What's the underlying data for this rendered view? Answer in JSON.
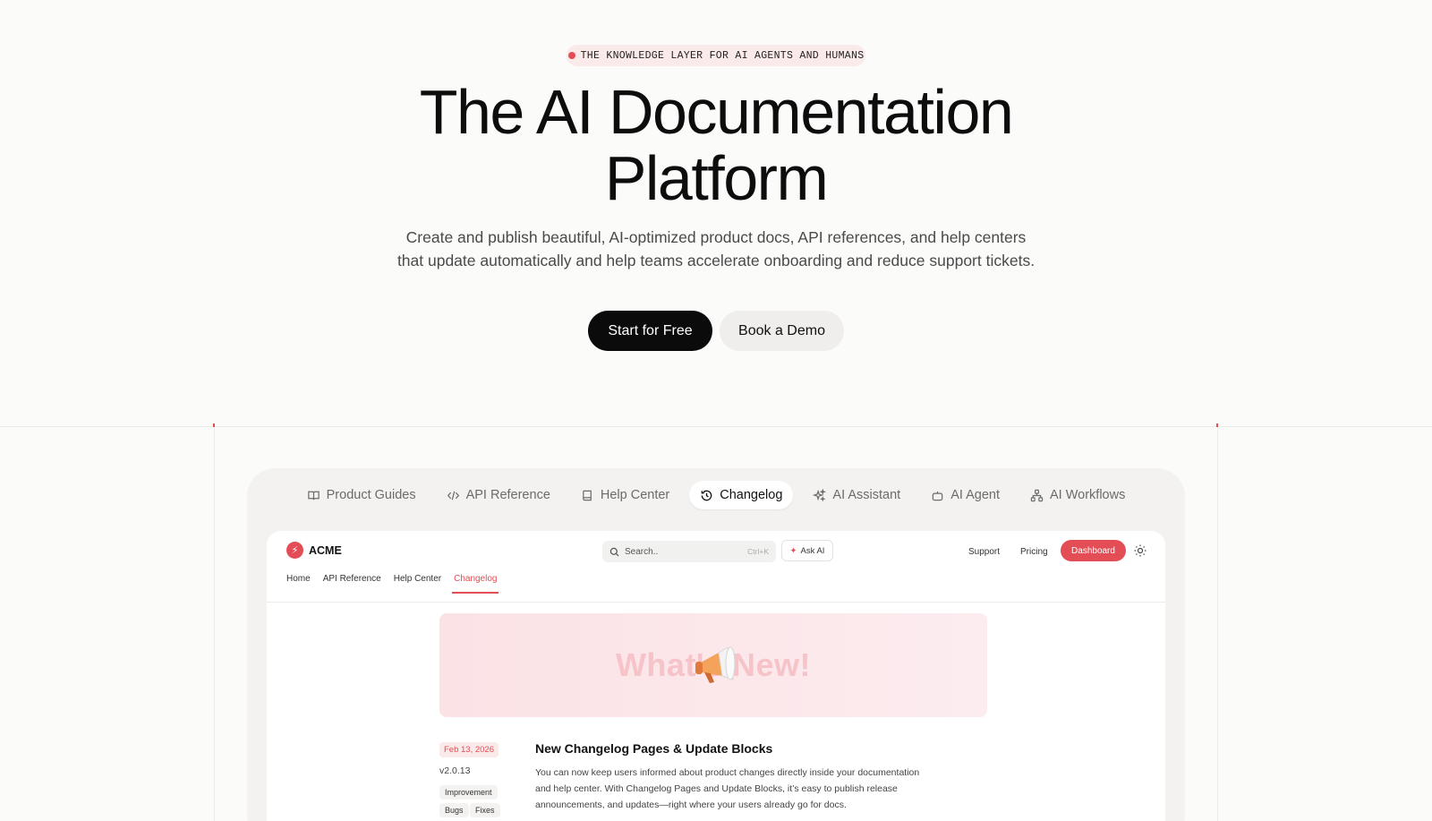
{
  "hero": {
    "eyebrow": "THE KNOWLEDGE LAYER FOR AI AGENTS AND HUMANS",
    "title_line1": "The AI Documentation",
    "title_line2": "Platform",
    "subtitle_line1": "Create and publish beautiful, AI-optimized product docs, API references, and help centers",
    "subtitle_line2": "that update automatically and help teams accelerate onboarding and reduce support tickets.",
    "cta_primary": "Start for Free",
    "cta_secondary": "Book a Demo"
  },
  "tabs": [
    {
      "label": "Product Guides",
      "icon": "book-open-icon"
    },
    {
      "label": "API Reference",
      "icon": "code-icon"
    },
    {
      "label": "Help Center",
      "icon": "book-icon"
    },
    {
      "label": "Changelog",
      "icon": "history-icon",
      "active": true
    },
    {
      "label": "AI Assistant",
      "icon": "sparkles-icon"
    },
    {
      "label": "AI Agent",
      "icon": "bot-icon"
    },
    {
      "label": "AI Workflows",
      "icon": "workflow-icon"
    }
  ],
  "app": {
    "brand": "ACME",
    "search_placeholder": "Search..",
    "search_shortcut": "Ctrl+K",
    "ask_ai": "Ask AI",
    "nav_support": "Support",
    "nav_pricing": "Pricing",
    "dashboard": "Dashboard",
    "subnav": [
      "Home",
      "API Reference",
      "Help Center",
      "Changelog"
    ],
    "banner_text": "What's New!",
    "entry": {
      "date": "Feb 13, 2026",
      "version": "v2.0.13",
      "tags": [
        "Improvement",
        "Bugs",
        "Fixes"
      ],
      "title": "New Changelog Pages & Update Blocks",
      "body_line1": "You can now keep users informed about product changes directly inside your documentation",
      "body_line2": "and help center. With Changelog Pages and Update Blocks, it’s easy to publish release",
      "body_line3": "announcements, and updates—right where your users already go for docs."
    }
  },
  "colors": {
    "accent": "#e34d55",
    "primary_button": "#0b0b0b",
    "background": "#fbfbfa"
  }
}
